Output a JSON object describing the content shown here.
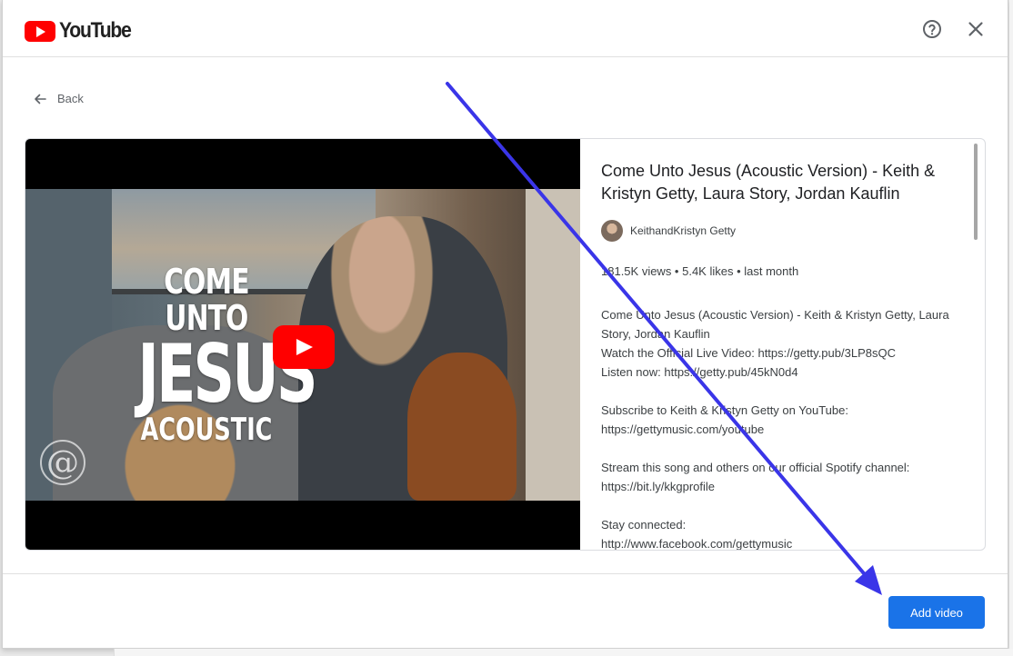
{
  "header": {
    "logo_text": "YouTube",
    "help_icon": "help-circle-icon",
    "close_icon": "close-icon"
  },
  "back": {
    "label": "Back",
    "icon": "arrow-left-icon"
  },
  "video": {
    "thumbnail_text": {
      "line1": "COME UNTO",
      "line2": "JESUS",
      "line3": "ACOUSTIC"
    },
    "thumbnail_logo": "@",
    "play_icon": "youtube-play-icon",
    "title": "Come Unto Jesus (Acoustic Version) - Keith & Kristyn Getty, Laura Story, Jordan Kauflin",
    "channel": "KeithandKristyn Getty",
    "stats": "181.5K views • 5.4K likes • last month",
    "description": "Come Unto Jesus (Acoustic Version) - Keith & Kristyn Getty, Laura Story, Jordan Kauflin\nWatch the Official Live Video: https://getty.pub/3LP8sQC\nListen now: https://getty.pub/45kN0d4\n\nSubscribe to Keith & Kristyn Getty on YouTube:\nhttps://gettymusic.com/youtube\n\nStream this song and others on our official Spotify channel:\nhttps://bit.ly/kkgprofile\n\nStay connected:\nhttp://www.facebook.com/gettymusic"
  },
  "footer": {
    "add_label": "Add video"
  },
  "colors": {
    "accent": "#1a73e8",
    "youtube_red": "#ff0000",
    "annotation_arrow": "#3a35e8"
  }
}
